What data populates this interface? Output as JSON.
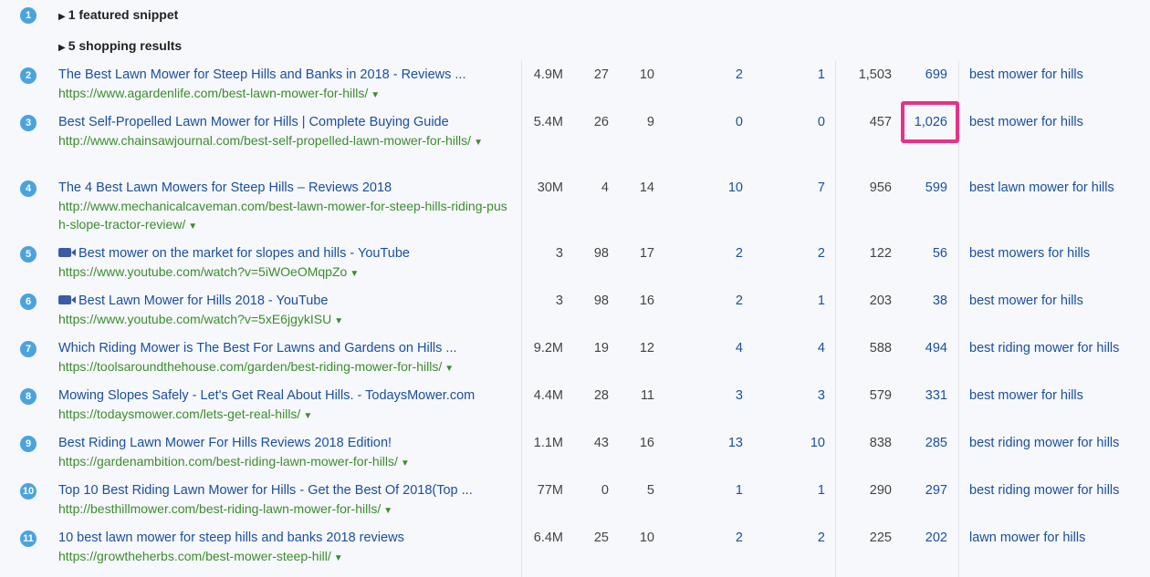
{
  "features": [
    {
      "pos": "1",
      "label": "1 featured snippet"
    },
    {
      "label": "5 shopping results"
    }
  ],
  "rows": [
    {
      "pos": "2",
      "video": false,
      "title": "The Best Lawn Mower for Steep Hills and Banks in 2018 - Reviews ...",
      "url": "https://www.agardenlife.com/best-lawn-mower-for-hills/",
      "ur": "4.9M",
      "dr": "27",
      "ar": "10",
      "rd": "2",
      "bl": "1",
      "traffic": "1,503",
      "kw_count": "699",
      "top_kw": "best mower for hills"
    },
    {
      "pos": "3",
      "video": false,
      "title": "Best Self-Propelled Lawn Mower for Hills | Complete Buying Guide",
      "url": "http://www.chainsawjournal.com/best-self-propelled-lawn-mower-for-hills/",
      "ur": "5.4M",
      "dr": "26",
      "ar": "9",
      "rd": "0",
      "bl": "0",
      "traffic": "457",
      "kw_count": "1,026",
      "top_kw": "best mower for hills"
    },
    {
      "pos": "4",
      "video": false,
      "title": "The 4 Best Lawn Mowers for Steep Hills – Reviews 2018",
      "url": "http://www.mechanicalcaveman.com/best-lawn-mower-for-steep-hills-riding-push-slope-tractor-review/",
      "ur": "30M",
      "dr": "4",
      "ar": "14",
      "rd": "10",
      "bl": "7",
      "traffic": "956",
      "kw_count": "599",
      "top_kw": "best lawn mower for hills"
    },
    {
      "pos": "5",
      "video": true,
      "title": "Best mower on the market for slopes and hills - YouTube",
      "url": "https://www.youtube.com/watch?v=5iWOeOMqpZo",
      "ur": "3",
      "dr": "98",
      "ar": "17",
      "rd": "2",
      "bl": "2",
      "traffic": "122",
      "kw_count": "56",
      "top_kw": "best mowers for hills"
    },
    {
      "pos": "6",
      "video": true,
      "title": "Best Lawn Mower for Hills 2018 - YouTube",
      "url": "https://www.youtube.com/watch?v=5xE6jgykISU",
      "ur": "3",
      "dr": "98",
      "ar": "16",
      "rd": "2",
      "bl": "1",
      "traffic": "203",
      "kw_count": "38",
      "top_kw": "best mower for hills"
    },
    {
      "pos": "7",
      "video": false,
      "title": "Which Riding Mower is The Best For Lawns and Gardens on Hills ...",
      "url": "https://toolsaroundthehouse.com/garden/best-riding-mower-for-hills/",
      "ur": "9.2M",
      "dr": "19",
      "ar": "12",
      "rd": "4",
      "bl": "4",
      "traffic": "588",
      "kw_count": "494",
      "top_kw": "best riding mower for hills"
    },
    {
      "pos": "8",
      "video": false,
      "title": "Mowing Slopes Safely - Let's Get Real About Hills. - TodaysMower.com",
      "url": "https://todaysmower.com/lets-get-real-hills/",
      "ur": "4.4M",
      "dr": "28",
      "ar": "11",
      "rd": "3",
      "bl": "3",
      "traffic": "579",
      "kw_count": "331",
      "top_kw": "best mower for hills"
    },
    {
      "pos": "9",
      "video": false,
      "title": "Best Riding Lawn Mower For Hills Reviews 2018 Edition!",
      "url": "https://gardenambition.com/best-riding-lawn-mower-for-hills/",
      "ur": "1.1M",
      "dr": "43",
      "ar": "16",
      "rd": "13",
      "bl": "10",
      "traffic": "838",
      "kw_count": "285",
      "top_kw": "best riding mower for hills"
    },
    {
      "pos": "10",
      "video": false,
      "title": "Top 10 Best Riding Lawn Mower for Hills - Get the Best Of 2018(Top ...",
      "url": "http://besthillmower.com/best-riding-lawn-mower-for-hills/",
      "ur": "77M",
      "dr": "0",
      "ar": "5",
      "rd": "1",
      "bl": "1",
      "traffic": "290",
      "kw_count": "297",
      "top_kw": "best riding mower for hills"
    },
    {
      "pos": "11",
      "video": false,
      "title": "10 best lawn mower for steep hills and banks 2018 reviews",
      "url": "https://growtheherbs.com/best-mower-steep-hill/",
      "ur": "6.4M",
      "dr": "25",
      "ar": "10",
      "rd": "2",
      "bl": "2",
      "traffic": "225",
      "kw_count": "202",
      "top_kw": "lawn mower for hills"
    }
  ],
  "caret_glyph": "▼",
  "expand_glyph": "▶",
  "colors": {
    "position_badge": "#4aa3df",
    "link": "#1a4fa0",
    "url": "#3a8d2e",
    "highlight": "#e8318a"
  }
}
